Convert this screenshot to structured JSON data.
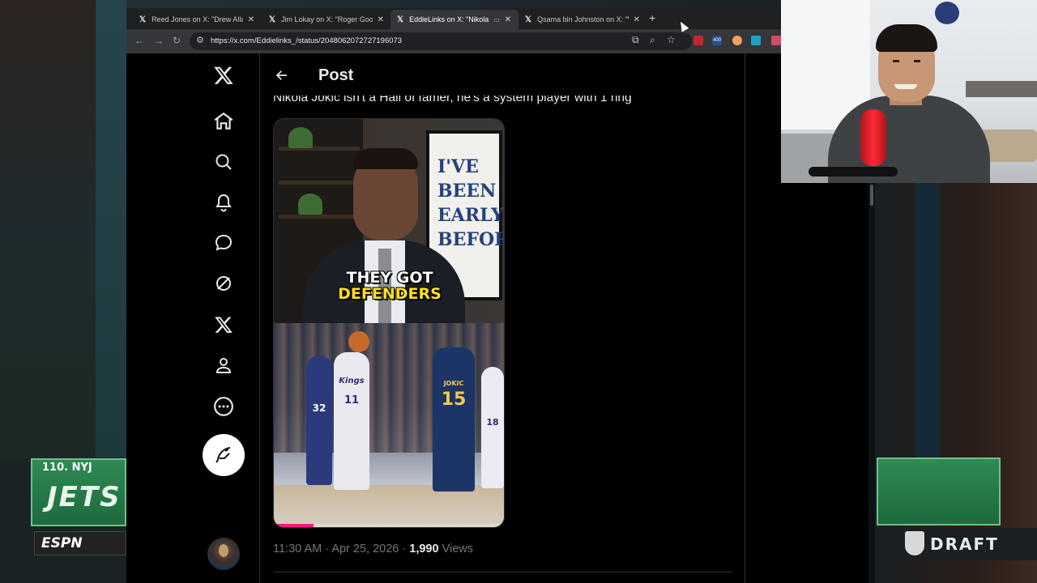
{
  "browser": {
    "tabs": [
      {
        "label": "Reed Jones on X: \"Drew Allar, w",
        "active": false
      },
      {
        "label": "Jim Lokay on X: \"Roger Goodell",
        "active": false
      },
      {
        "label": "EddieLinks on X: \"Nikola Jo",
        "active": true
      },
      {
        "label": "Qsama bin Johnston on X: \"Wa",
        "active": false
      }
    ],
    "url": "https://x.com/Eddielinks_/status/2048062072727196073",
    "extension_badge": "400"
  },
  "x": {
    "page_title": "Post",
    "tweet_text": "Nikola Jokic isn't a Hall of famer, he's a system player with 1 ring",
    "video": {
      "caption_line1": "THEY GOT",
      "caption_line2": "DEFENDERS",
      "poster_text": "I'VE BEEN EARLY BEFORE",
      "jersey_left": "11",
      "jersey_left_team": "Kings",
      "jersey_right": "15",
      "jersey_right_name": "JOKIC",
      "jersey_far_right": "18",
      "jersey_far_left": "32",
      "progress": 0.17
    },
    "meta": {
      "time": "11:30 AM",
      "sep1": "·",
      "date": "Apr 25, 2026",
      "sep2": "·",
      "views": "1,990",
      "views_label": "Views"
    }
  },
  "overlay": {
    "pick_label": "110. NYJ",
    "team_word": "JETS",
    "network": "ESPN",
    "draft_label": "DRAFT"
  },
  "colors": {
    "accent_pink": "#f91880",
    "x_text": "#e7e9ea",
    "x_muted": "#71767b",
    "caption_yellow": "#ffe01a"
  }
}
